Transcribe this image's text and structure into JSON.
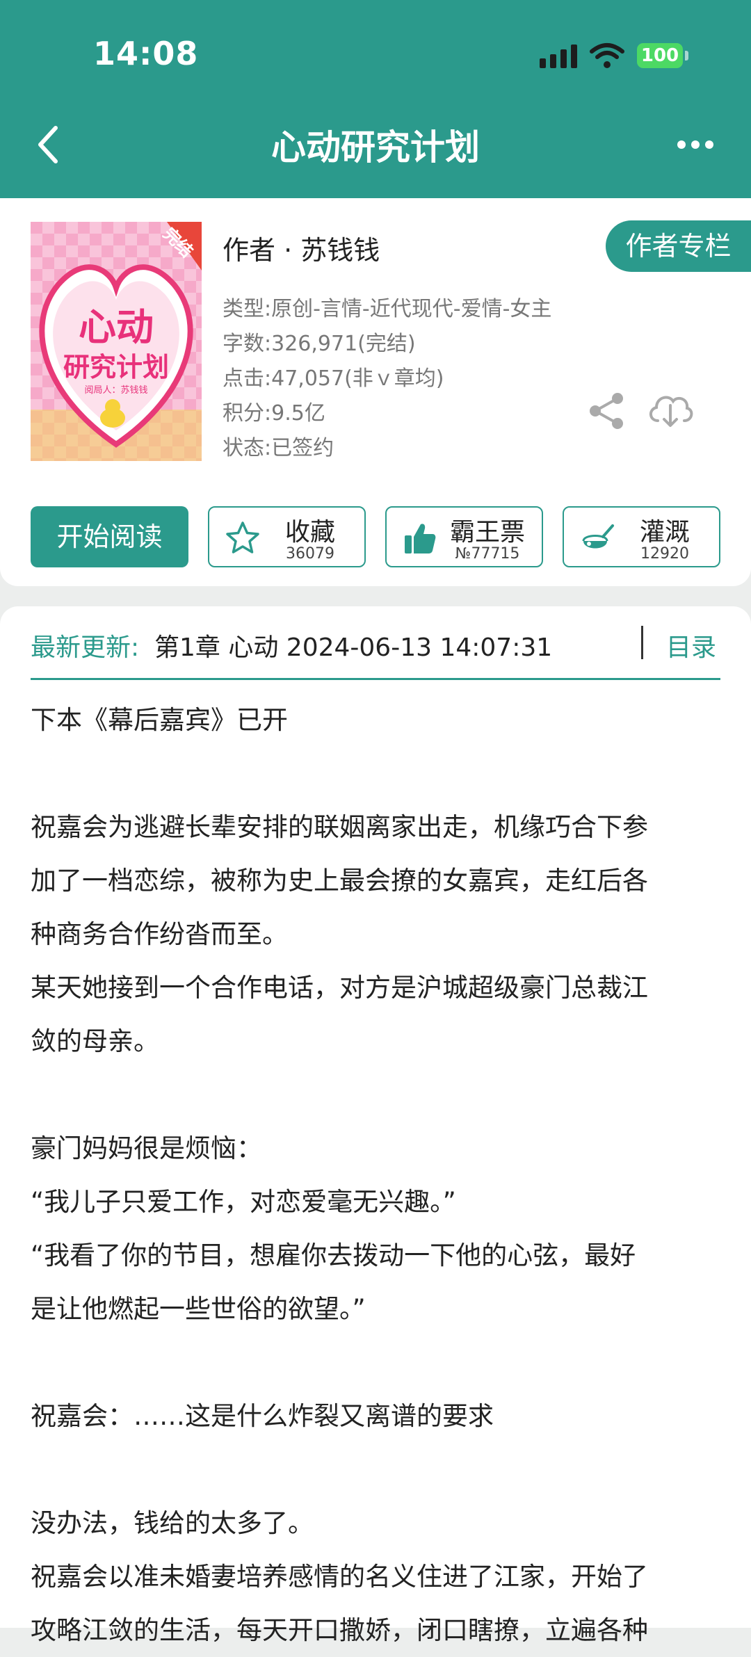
{
  "status_bar": {
    "time": "14:08",
    "battery": "100"
  },
  "nav": {
    "title": "心动研究计划"
  },
  "book": {
    "cover": {
      "badge": "完结",
      "title_line1": "心动",
      "title_line2": "研究计划",
      "subtitle": "阅局人：苏钱钱"
    },
    "author": "作者 · 苏钱钱",
    "author_column_label": "作者专栏",
    "meta": [
      "类型:原创-言情-近代现代-爱情-女主",
      "字数:326,971(完结)",
      "点击:47,057(非ｖ章均)",
      "积分:9.5亿",
      "状态:已签约"
    ]
  },
  "actions": {
    "read_label": "开始阅读",
    "favorite": {
      "label": "收藏",
      "count": "36079"
    },
    "vote": {
      "label": "霸王票",
      "count": "№77715"
    },
    "water": {
      "label": "灌溉",
      "count": "12920"
    }
  },
  "latest": {
    "label": "最新更新:",
    "text": "第1章 心动 2024-06-13 14:07:31",
    "toc_label": "目录"
  },
  "intro": [
    "下本《幕后嘉宾》已开",
    "",
    "祝嘉会为逃避长辈安排的联姻离家出走，机缘巧合下参",
    "加了一档恋综，被称为史上最会撩的女嘉宾，走红后各",
    "种商务合作纷沓而至。",
    "某天她接到一个合作电话，对方是沪城超级豪门总裁江",
    "敛的母亲。",
    "",
    "豪门妈妈很是烦恼：",
    "“我儿子只爱工作，对恋爱毫无兴趣。”",
    "“我看了你的节目，想雇你去拨动一下他的心弦，最好",
    "是让他燃起一些世俗的欲望。”",
    "",
    "祝嘉会：……这是什么炸裂又离谱的要求",
    "",
    "没办法，钱给的太多了。",
    "祝嘉会以准未婚妻培养感情的名义住进了江家，开始了",
    "攻略江敛的生活，每天开口撒娇，闭口瞎撩，立遍各种"
  ],
  "colors": {
    "accent": "#2b9a8c",
    "battery": "#4cd964"
  }
}
